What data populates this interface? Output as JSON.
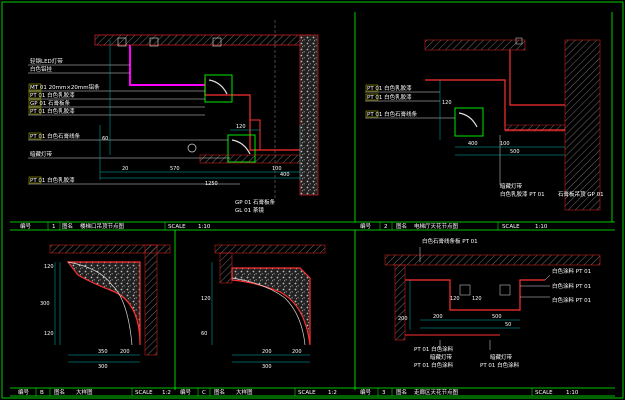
{
  "colors": {
    "background": "#000000",
    "frame": "#00ff00",
    "wall": "#c81e1e",
    "section_line": "#ff3030",
    "leader": "#ffffff",
    "label_text": "#ffffff",
    "dim_line": "#00b4b4",
    "dim_text": "#ffffff",
    "tag_box": "#ffff00",
    "led": "#ff00ff",
    "title_bar_text": "#ffffff"
  },
  "panel1": {
    "labels": [
      "轻钢LED灯带",
      "白色铝挂",
      "MT 01 20mm×20mm铝条",
      "PT 01 白色乳胶漆",
      "GP 01 石膏板条",
      "PT 01 白色乳胶漆",
      "PT 01 白色石膏线条",
      "暗藏灯带",
      "PT 01 白色乳胶漆"
    ],
    "bottom_tags": [
      "GP 01 石膏板条",
      "GL 01 茶镜"
    ],
    "dims": [
      "120",
      "100",
      "570",
      "400",
      "1250",
      "20",
      "60"
    ],
    "title": {
      "no_label": "编号",
      "no": "1",
      "name_label": "图名",
      "name": "楼梯口吊顶节点图",
      "scale_label": "SCALE",
      "scale": "1:10"
    }
  },
  "panel2": {
    "labels": [
      "PT 01 白色乳胶漆",
      "PT 01 白色乳胶漆",
      "PT 01 白色石膏线条"
    ],
    "bottom_labels": [
      "暗藏灯带",
      "白色乳胶漆 PT 01",
      "石膏板吊顶 GP 01"
    ],
    "dims": [
      "100",
      "400",
      "500",
      "120"
    ],
    "title": {
      "no_label": "编号",
      "no": "2",
      "name_label": "图名",
      "name": "电梯厅天花节点图",
      "scale_label": "SCALE",
      "scale": "1:10"
    }
  },
  "panel3": {
    "dims": [
      "120",
      "120",
      "300",
      "350",
      "300",
      "200"
    ],
    "title": {
      "no_label": "编号",
      "no": "B",
      "name_label": "图名",
      "name": "大样图",
      "scale_label": "SCALE",
      "scale": "1:2"
    }
  },
  "panel4": {
    "dims": [
      "120",
      "60",
      "200",
      "300",
      "200"
    ],
    "title": {
      "no_label": "编号",
      "no": "C",
      "name_label": "图名",
      "name": "大样图",
      "scale_label": "SCALE",
      "scale": "1:2"
    }
  },
  "panel5": {
    "top_label": "白色石膏线条板 PT 01",
    "right_labels": [
      "白色涂料 PT 01",
      "白色涂料 PT 01",
      "白色涂料 PT 01"
    ],
    "bottom_labels": [
      "PT 01 白色涂料",
      "暗藏灯带",
      "PT 01 白色涂料",
      "暗藏灯带",
      "PT 01 白色涂料"
    ],
    "dims": [
      "120",
      "120",
      "200",
      "500",
      "50",
      "200"
    ],
    "title": {
      "no_label": "编号",
      "no": "3",
      "name_label": "图名",
      "name": "走廊区天花节点图",
      "scale_label": "SCALE",
      "scale": "1:10"
    }
  }
}
